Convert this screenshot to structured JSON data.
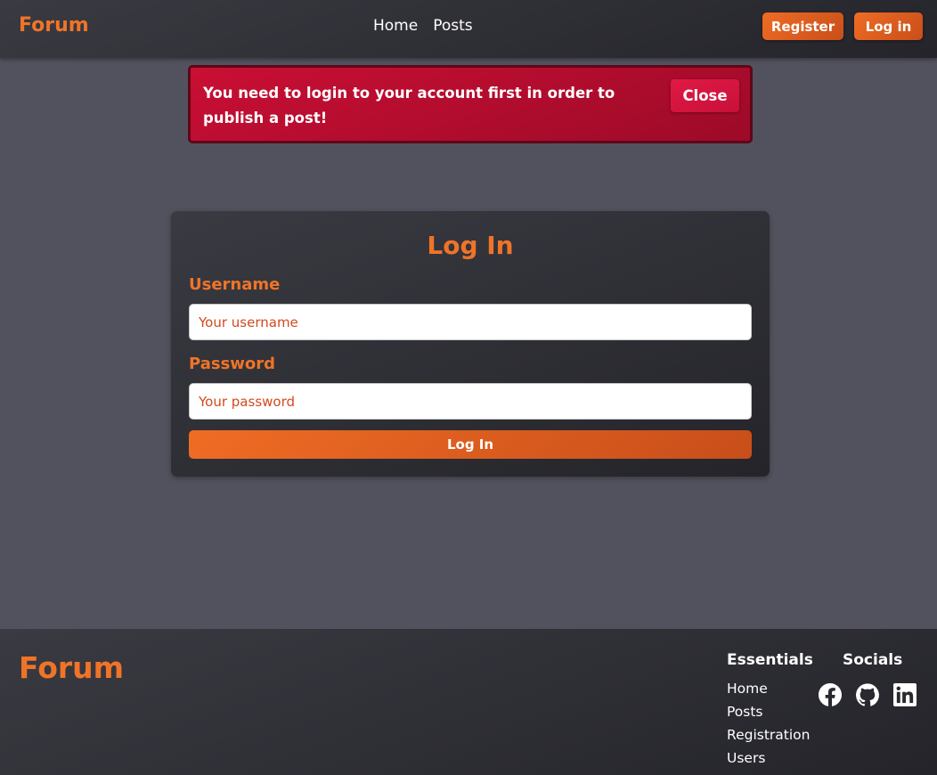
{
  "header": {
    "brand": "Forum",
    "nav": [
      {
        "label": "Home"
      },
      {
        "label": "Posts"
      }
    ],
    "register_label": "Register",
    "login_label": "Log in"
  },
  "alert": {
    "message": "You need to login to your account first in order to publish a post!",
    "close_label": "Close"
  },
  "login_form": {
    "title": "Log In",
    "username_label": "Username",
    "username_placeholder": "Your username",
    "username_value": "",
    "password_label": "Password",
    "password_placeholder": "Your password",
    "password_value": "",
    "submit_label": "Log In"
  },
  "footer": {
    "brand": "Forum",
    "essentials_heading": "Essentials",
    "essentials_links": [
      {
        "label": "Home"
      },
      {
        "label": "Posts"
      },
      {
        "label": "Registration"
      },
      {
        "label": "Users"
      }
    ],
    "socials_heading": "Socials",
    "socials": [
      {
        "icon": "facebook-icon"
      },
      {
        "icon": "github-icon"
      },
      {
        "icon": "linkedin-icon"
      }
    ]
  },
  "colors": {
    "accent": "#ef7428",
    "background": "#52525e",
    "surface": "#2e2e35",
    "alert": "#b80c2e"
  }
}
